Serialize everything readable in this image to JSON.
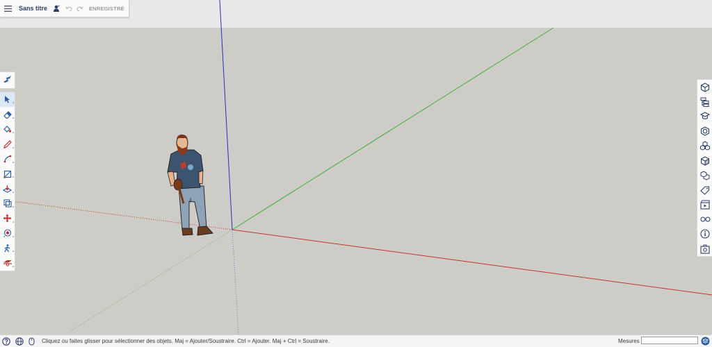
{
  "app": {
    "document_title": "Sans titre",
    "save_status": "ENREGISTRÉ"
  },
  "titlebar": {
    "icons": [
      "menu-icon",
      "user-icon",
      "undo-icon",
      "redo-icon"
    ]
  },
  "left_toolbar": {
    "single_tool": "search-warehouse-icon",
    "tools": [
      "select-icon",
      "eraser-icon",
      "paint-bucket-icon",
      "pencil-icon",
      "line-icon",
      "rectangle-icon",
      "push-pull-icon",
      "offset-icon",
      "move-icon",
      "tape-measure-icon",
      "walk-icon",
      "section-plane-icon"
    ],
    "active_tool": "select-icon"
  },
  "right_panel": {
    "items": [
      "entity-info-icon",
      "outliner-icon",
      "instructor-icon",
      "styles-icon",
      "components-icon",
      "materials-icon",
      "scenes-icon",
      "tags-icon",
      "animation-icon",
      "display-icon",
      "info-icon",
      "extensions-icon"
    ]
  },
  "statusbar": {
    "hint": "Cliquez ou faites glisser pour sélectionner des objets. Maj = Ajouter/Soustraire. Ctrl = Ajouter. Maj + Ctrl = Soustraire.",
    "measurements_label": "Mesures",
    "measurements_value": ""
  },
  "colors": {
    "axis_red": "#c0342f",
    "axis_green": "#3fae3c",
    "axis_blue": "#2b2bb8",
    "accent": "#2a5fa8"
  }
}
